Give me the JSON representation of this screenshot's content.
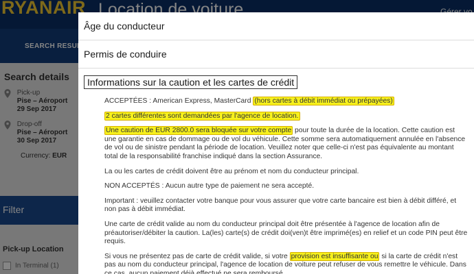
{
  "background": {
    "logo": "RYANAIR",
    "page_title": "Location de voiture",
    "manage_link": "Gérer vo",
    "nav_tab": "SEARCH RESULT",
    "search_details": {
      "title": "Search details",
      "pickup_label": "Pick-up",
      "pickup_place": "Pise – Aéroport",
      "pickup_date": "29 Sep 2017",
      "dropoff_label": "Drop-off",
      "dropoff_place": "Pise – Aéroport",
      "dropoff_date": "30 Sep 2017",
      "currency_label": "Currency:",
      "currency_value": "EUR"
    },
    "filter_label": "Filter",
    "pickup_location_label": "Pick-up Location",
    "checkbox_label": "In Terminal (1)"
  },
  "modal": {
    "sections": [
      {
        "label": "Âge du conducteur"
      },
      {
        "label": "Permis de conduire"
      },
      {
        "label": "Informations sur la caution et les cartes de crédit"
      }
    ],
    "content": {
      "accepted_prefix": "ACCEPTÉES : American Express, MasterCard ",
      "accepted_highlight": "(hors cartes à débit immédiat ou prépayées)",
      "two_cards_highlight": "2 cartes différentes sont demandées par l'agence de location.",
      "deposit_highlight": "Une caution de EUR 2800.0 sera bloquée sur votre compte",
      "deposit_rest": " pour toute la durée de la location. Cette caution est une garantie en cas de dommage ou de vol du véhicule. Cette somme sera automatiquement annulée en l'absence de vol ou de sinistre pendant la période de location. Veuillez noter que celle-ci n'est pas équivalente au montant total de la responsabilité franchise indiqué dans la section Assurance.",
      "name_note": "La ou les cartes de crédit doivent être au prénom et nom du conducteur principal.",
      "not_accepted": "NON ACCEPTÉS : Aucun autre type de paiement ne sera accepté.",
      "important": "Important : veuillez contacter votre banque pour vous assurer que votre carte bancaire est bien à débit différé, et non pas à débit immédiat.",
      "valid_card": "Une carte de crédit valide au nom du conducteur principal doit être présentée à l'agence de location afin de préautoriser/débiter la caution. La(les) carte(s) de crédit doi(ven)t être imprimé(es) en relief et un code PIN peut être requis.",
      "insufficient_prefix": "Si vous ne présentez pas de carte de crédit valide, si votre ",
      "insufficient_highlight": "provision est insuffisante ou",
      "insufficient_rest": " si la carte de crédit n'est pas au nom du conducteur principal, l'agence de location de voiture peut refuser de vous remettre le véhicule. Dans ce cas, aucun paiement déjà effectué ne sera remboursé."
    }
  },
  "colors": {
    "brand_navy": "#0b2e66",
    "brand_yellow": "#f1c933",
    "highlight": "#f6f01c"
  }
}
